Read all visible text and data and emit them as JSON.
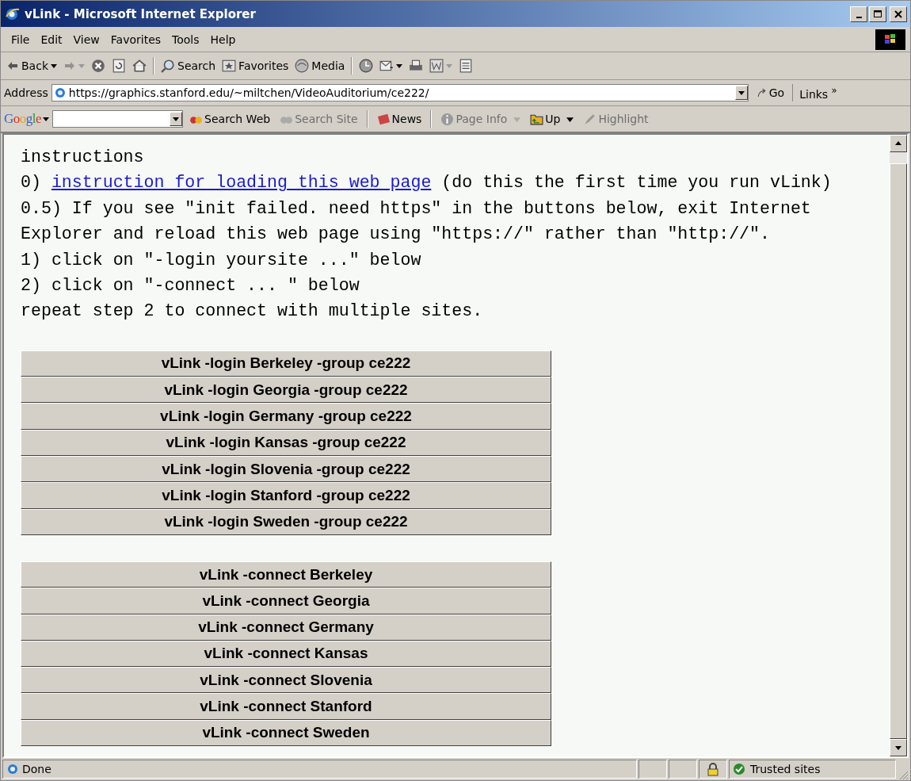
{
  "window": {
    "title": "vLink - Microsoft Internet Explorer"
  },
  "menu": [
    "File",
    "Edit",
    "View",
    "Favorites",
    "Tools",
    "Help"
  ],
  "toolbar": [
    {
      "kind": "back",
      "label": "Back"
    },
    {
      "kind": "forward"
    },
    {
      "kind": "stop"
    },
    {
      "kind": "refresh"
    },
    {
      "kind": "home"
    },
    {
      "kind": "search",
      "label": "Search"
    },
    {
      "kind": "favorites",
      "label": "Favorites"
    },
    {
      "kind": "media",
      "label": "Media"
    },
    {
      "kind": "history"
    },
    {
      "kind": "mail"
    },
    {
      "kind": "print"
    },
    {
      "kind": "edit"
    },
    {
      "kind": "discuss"
    }
  ],
  "address": {
    "label": "Address",
    "value": "https://graphics.stanford.edu/~miltchen/VideoAuditorium/ce222/",
    "go": "Go",
    "links": "Links",
    "more": "»"
  },
  "google_bar": {
    "logo": "Google",
    "items": [
      {
        "label": "Search Web",
        "disabled": false,
        "kind": "binoculars"
      },
      {
        "label": "Search Site",
        "disabled": true,
        "kind": "binoculars"
      },
      {
        "label": "News",
        "disabled": false,
        "kind": "news"
      },
      {
        "label": "Page Info",
        "disabled": true,
        "kind": "info"
      },
      {
        "label": "Up",
        "disabled": false,
        "kind": "folder"
      },
      {
        "label": "Highlight",
        "disabled": true,
        "kind": "marker"
      }
    ]
  },
  "instructions": [
    {
      "kind": "text",
      "text": "instructions"
    },
    {
      "kind": "link",
      "prefix": "0) ",
      "link": "instruction for loading this web page",
      "suffix": " (do this the first time you run vLink)"
    },
    {
      "kind": "text",
      "text": "0.5) If you see \"init failed. need https\" in the buttons below, exit Internet Explorer and reload this web page using \"https://\" rather than \"http://\"."
    },
    {
      "kind": "text",
      "text": "1) click on \"-login yoursite ...\" below"
    },
    {
      "kind": "text",
      "text": "2) click on \"-connect ... \" below"
    },
    {
      "kind": "text",
      "text": "repeat step 2 to connect with multiple sites."
    }
  ],
  "login_buttons": [
    "vLink -login Berkeley -group ce222",
    "vLink -login Georgia -group ce222",
    "vLink -login Germany -group ce222",
    "vLink -login Kansas -group ce222",
    "vLink -login Slovenia -group ce222",
    "vLink -login Stanford -group ce222",
    "vLink -login Sweden -group ce222"
  ],
  "connect_buttons": [
    "vLink -connect Berkeley",
    "vLink -connect Georgia",
    "vLink -connect Germany",
    "vLink -connect Kansas",
    "vLink -connect Slovenia",
    "vLink -connect Stanford",
    "vLink -connect Sweden"
  ],
  "status_bar": {
    "text": "Done",
    "zone": "Trusted sites"
  }
}
